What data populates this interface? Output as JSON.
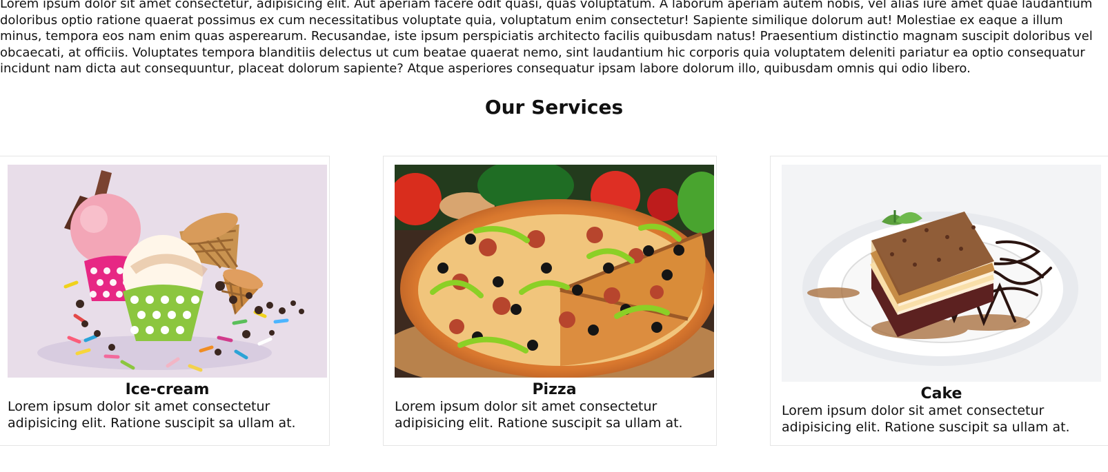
{
  "intro": {
    "text": "Lorem ipsum dolor sit amet consectetur, adipisicing elit. Aut aperiam facere odit quasi, quas voluptatum. A laborum aperiam autem nobis, vel alias iure amet quae laudantium doloribus optio ratione quaerat possimus ex cum necessitatibus voluptate quia, voluptatum enim consectetur! Sapiente similique dolorum aut! Molestiae ex eaque a illum minus, tempora eos nam enim quas asperearum. Recusandae, iste ipsum perspiciatis architecto facilis quibusdam natus! Praesentium distinctio magnam suscipit doloribus vel obcaecati, at officiis. Voluptates tempora blanditiis delectus ut cum beatae quaerat nemo, sint laudantium hic corporis quia voluptatem deleniti pariatur ea optio consequatur incidunt nam dicta aut consequuntur, placeat dolorum sapiente? Atque asperiores consequatur ipsam labore dolorum illo, quibusdam omnis qui odio libero."
  },
  "services": {
    "title": "Our Services",
    "items": [
      {
        "title": "Ice-cream",
        "text": "Lorem ipsum dolor sit amet consectetur adipisicing elit. Ratione suscipit sa ullam at.",
        "image_icon": "ice-cream-image"
      },
      {
        "title": "Pizza",
        "text": "Lorem ipsum dolor sit amet consectetur adipisicing elit. Ratione suscipit sa ullam at.",
        "image_icon": "pizza-image"
      },
      {
        "title": "Cake",
        "text": "Lorem ipsum dolor sit amet consectetur adipisicing elit. Ratione suscipit sa ullam at.",
        "image_icon": "cake-image"
      }
    ]
  },
  "colors": {
    "background": "#ffffff",
    "text": "#111111",
    "card_border": "#e5e5e5"
  }
}
